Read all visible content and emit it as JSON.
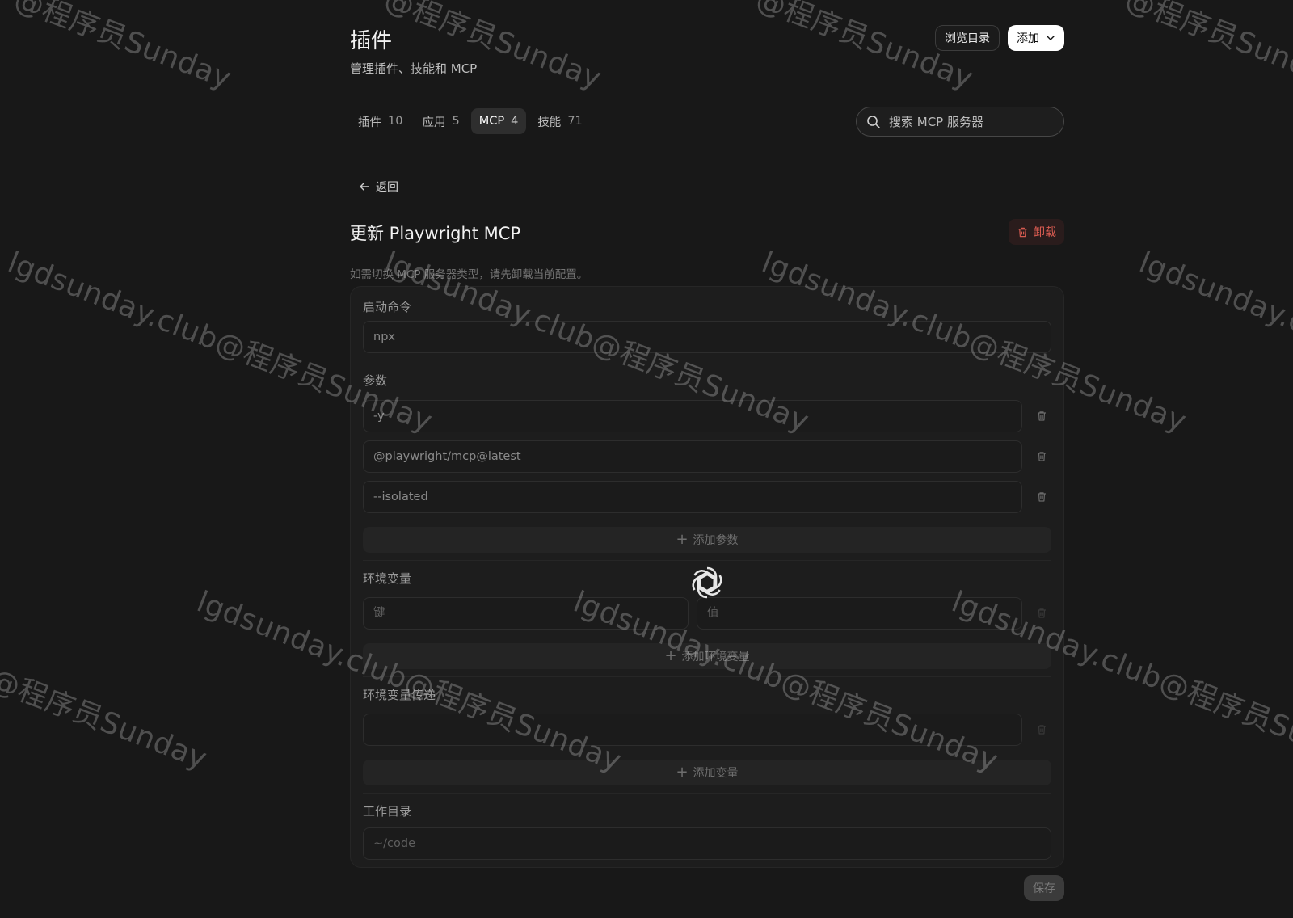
{
  "header": {
    "title": "插件",
    "subtitle": "管理插件、技能和 MCP",
    "browse_label": "浏览目录",
    "add_label": "添加"
  },
  "tabs": [
    {
      "label": "插件",
      "count": "10",
      "active": false
    },
    {
      "label": "应用",
      "count": "5",
      "active": false
    },
    {
      "label": "MCP",
      "count": "4",
      "active": true
    },
    {
      "label": "技能",
      "count": "71",
      "active": false
    }
  ],
  "search": {
    "placeholder": "搜索 MCP 服务器"
  },
  "detail": {
    "back_label": "返回",
    "title": "更新 Playwright MCP",
    "uninstall_label": "卸载",
    "hint": "如需切换 MCP 服务器类型，请先卸载当前配置。"
  },
  "form": {
    "command": {
      "label": "启动命令",
      "value": "npx"
    },
    "args": {
      "label": "参数",
      "items": [
        "-y",
        "@playwright/mcp@latest",
        "--isolated"
      ],
      "add_label": "添加参数"
    },
    "env": {
      "label": "环境变量",
      "key_placeholder": "键",
      "value_placeholder": "值",
      "add_label": "添加环境变量"
    },
    "env_passthrough": {
      "label": "环境变量传递",
      "value": "",
      "add_label": "添加变量"
    },
    "cwd": {
      "label": "工作目录",
      "placeholder": "~/code"
    },
    "save_label": "保存"
  },
  "watermark": {
    "text_a": "lgdsunday.club@程序员Sunday",
    "text_b": "@程序员Sunday"
  },
  "colors": {
    "background": "#181818",
    "danger": "#d65a50",
    "active_tab": "#2e2e2e"
  }
}
